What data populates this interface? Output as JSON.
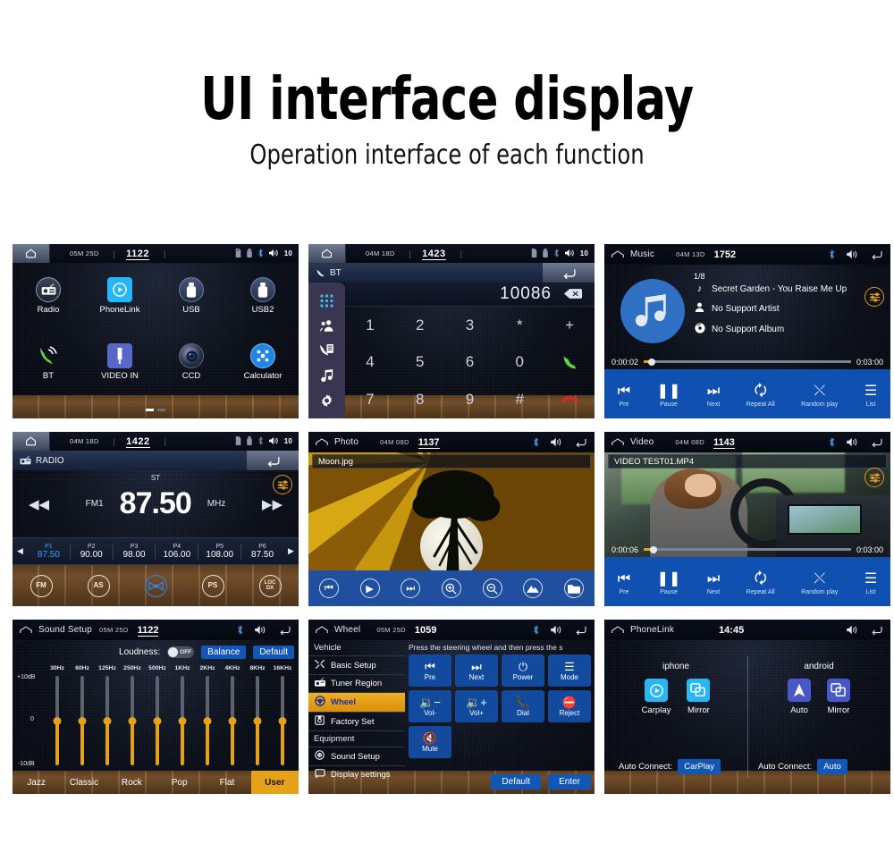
{
  "header": {
    "title": "UI interface display",
    "subtitle": "Operation interface of each function"
  },
  "colors": {
    "accent_blue": "#1050b0",
    "accent_orange": "#e3a21a",
    "panel_bg": "#05070f",
    "highlight_blue": "#3f9dfb"
  },
  "panels": {
    "home": {
      "name": "home-screen",
      "statusbar": {
        "home_icon": "home-icon",
        "date": "05M 25D",
        "clock": "11:22",
        "clock_display": "1122",
        "icons": [
          "sd-card-icon",
          "usb-icon",
          "bluetooth-icon",
          "volume-icon"
        ],
        "volume": "10"
      },
      "apps": [
        {
          "label": "Radio",
          "icon": "radio-icon"
        },
        {
          "label": "PhoneLink",
          "icon": "play-circle-icon"
        },
        {
          "label": "USB",
          "icon": "usb-icon"
        },
        {
          "label": "USB2",
          "icon": "usb-icon"
        },
        {
          "label": "BT",
          "icon": "phone-bluetooth-icon"
        },
        {
          "label": "VIDEO IN",
          "icon": "video-in-icon"
        },
        {
          "label": "CCD",
          "icon": "camera-icon"
        },
        {
          "label": "Calculator",
          "icon": "calculator-icon"
        }
      ],
      "page_dots": 2,
      "active_dot": 0
    },
    "bt": {
      "name": "bluetooth-dialer",
      "statusbar": {
        "date": "04M 18D",
        "clock_display": "1423",
        "volume": "10"
      },
      "subtitle": "BT",
      "back_icon": "back-arrow-icon",
      "sidebar": [
        "keypad-icon",
        "contacts-icon",
        "call-log-icon",
        "bt-music-icon",
        "bt-settings-icon"
      ],
      "dialed_number": "10086",
      "delete_icon": "backspace-icon",
      "keys": [
        "1",
        "2",
        "3",
        "*",
        "call-icon",
        "4",
        "5",
        "6",
        "0",
        "",
        "7",
        "8",
        "9",
        "#",
        "hangup-icon"
      ],
      "keys_flat": [
        {
          "k": "1"
        },
        {
          "k": "2"
        },
        {
          "k": "3"
        },
        {
          "k": "*"
        },
        {
          "k": "+"
        },
        {
          "k": "4"
        },
        {
          "k": "5"
        },
        {
          "k": "6"
        },
        {
          "k": "0"
        },
        {
          "k": "call-icon"
        },
        {
          "k": "7"
        },
        {
          "k": "8"
        },
        {
          "k": "9"
        },
        {
          "k": "#"
        },
        {
          "k": "hangup-icon"
        }
      ]
    },
    "music": {
      "name": "music-player",
      "statusbar": {
        "title": "Music",
        "date": "04M 13D",
        "clock_display": "1752"
      },
      "track_index": "1/8",
      "track_title": "Secret Garden - You Raise Me Up",
      "artist": "No Support Artist",
      "album": "No Support Album",
      "time_current": "0:00:02",
      "time_total": "0:03:00",
      "progress_pct": 2,
      "eq_badge": "equalizer-icon",
      "controls": [
        {
          "label": "Pre",
          "icon": "previous-icon"
        },
        {
          "label": "Pause",
          "icon": "pause-icon"
        },
        {
          "label": "Next",
          "icon": "next-icon"
        },
        {
          "label": "Repeat All",
          "icon": "repeat-icon"
        },
        {
          "label": "Random play",
          "icon": "shuffle-icon"
        },
        {
          "label": "List",
          "icon": "list-icon"
        }
      ]
    },
    "radio": {
      "name": "radio-tuner",
      "statusbar": {
        "date": "04M 18D",
        "clock_display": "1422",
        "volume": "10"
      },
      "subtitle": "RADIO",
      "stereo": "ST",
      "band": "FM1",
      "frequency": "87.50",
      "unit": "MHz",
      "presets": [
        {
          "name": "P1",
          "freq": "87.50",
          "active": true
        },
        {
          "name": "P2",
          "freq": "90.00",
          "active": false
        },
        {
          "name": "P3",
          "freq": "98.00",
          "active": false
        },
        {
          "name": "P4",
          "freq": "106.00",
          "active": false
        },
        {
          "name": "P5",
          "freq": "108.00",
          "active": false
        },
        {
          "name": "P6",
          "freq": "87.50",
          "active": false
        }
      ],
      "buttons": [
        {
          "label": "FM",
          "active": false
        },
        {
          "label": "AS",
          "active": false
        },
        {
          "label": "scan-icon",
          "active": true
        },
        {
          "label": "PS",
          "active": false
        },
        {
          "label": "LOC DX",
          "active": false
        }
      ]
    },
    "photo": {
      "name": "photo-viewer",
      "statusbar": {
        "title": "Photo",
        "date": "04M 08D",
        "clock_display": "1137"
      },
      "filename": "Moon.jpg",
      "controls": [
        {
          "icon": "previous-icon"
        },
        {
          "icon": "play-icon"
        },
        {
          "icon": "next-icon"
        },
        {
          "icon": "zoom-in-icon"
        },
        {
          "icon": "zoom-out-icon"
        },
        {
          "icon": "rotate-icon"
        },
        {
          "icon": "folder-icon"
        }
      ]
    },
    "video": {
      "name": "video-player",
      "statusbar": {
        "title": "Video",
        "date": "04M 08D",
        "clock_display": "1143"
      },
      "filename": "VIDEO TEST01.MP4",
      "time_current": "0:00:06",
      "time_total": "0:03:00",
      "progress_pct": 3,
      "eq_badge": "equalizer-icon",
      "controls": [
        {
          "label": "Pre",
          "icon": "previous-icon"
        },
        {
          "label": "Pause",
          "icon": "pause-icon"
        },
        {
          "label": "Next",
          "icon": "next-icon"
        },
        {
          "label": "Repeat All",
          "icon": "repeat-icon"
        },
        {
          "label": "Random play",
          "icon": "shuffle-icon"
        },
        {
          "label": "List",
          "icon": "list-icon"
        }
      ]
    },
    "sound": {
      "name": "sound-setup",
      "statusbar": {
        "title": "Sound Setup",
        "date": "05M 25D",
        "clock_display": "1122"
      },
      "loudness_label": "Loudness:",
      "loudness_state": "OFF",
      "balance_label": "Balance",
      "default_label": "Default",
      "bands": [
        "30Hz",
        "60Hz",
        "125Hz",
        "250Hz",
        "500Hz",
        "1KHz",
        "2KHz",
        "4KHz",
        "8KHz",
        "16KHz"
      ],
      "band_values": [
        0,
        0,
        0,
        0,
        0,
        0,
        0,
        0,
        0,
        0
      ],
      "scale_top": "+10dB",
      "scale_mid": "0",
      "scale_bottom": "-10dB",
      "eq_presets": [
        {
          "label": "Jazz",
          "active": false
        },
        {
          "label": "Classic",
          "active": false
        },
        {
          "label": "Rock",
          "active": false
        },
        {
          "label": "Pop",
          "active": false
        },
        {
          "label": "Flat",
          "active": false
        },
        {
          "label": "User",
          "active": true
        }
      ]
    },
    "wheel": {
      "name": "steering-wheel-setup",
      "statusbar": {
        "title": "Wheel",
        "date": "05M 25D",
        "clock_display": "1059"
      },
      "hint": "Press the steering wheel and then press the s",
      "menu": [
        {
          "label": "Vehicle",
          "type": "group"
        },
        {
          "label": "Basic Setup",
          "type": "item",
          "icon": "tools-icon",
          "active": false
        },
        {
          "label": "Tuner Region",
          "type": "item",
          "icon": "radio-icon",
          "active": false
        },
        {
          "label": "Wheel",
          "type": "item",
          "icon": "wheel-icon",
          "active": true
        },
        {
          "label": "Factory Set",
          "type": "item",
          "icon": "factory-icon",
          "active": false
        },
        {
          "label": "Equipment",
          "type": "group"
        },
        {
          "label": "Sound Setup",
          "type": "item",
          "icon": "speaker-icon",
          "active": false
        },
        {
          "label": "Display settings",
          "type": "item",
          "icon": "display-icon",
          "active": false
        }
      ],
      "keys": [
        {
          "label": "Pre",
          "icon": "previous-icon"
        },
        {
          "label": "Next",
          "icon": "next-icon"
        },
        {
          "label": "Power",
          "icon": "power-icon"
        },
        {
          "label": "Mode",
          "icon": "menu-icon"
        },
        {
          "label": "Vol-",
          "icon": "volume-down-icon"
        },
        {
          "label": "Vol+",
          "icon": "volume-up-icon"
        },
        {
          "label": "Dial",
          "icon": "dial-icon"
        },
        {
          "label": "Reject",
          "icon": "reject-call-icon"
        },
        {
          "label": "Mute",
          "icon": "mute-icon"
        }
      ],
      "footer": [
        {
          "label": "Default"
        },
        {
          "label": "Enter"
        }
      ]
    },
    "phonelink": {
      "name": "phonelink-screen",
      "statusbar": {
        "title": "PhoneLink",
        "clock_display": "14:45"
      },
      "iphone": {
        "title": "iphone",
        "items": [
          {
            "label": "Carplay",
            "icon": "carplay-icon"
          },
          {
            "label": "Mirror",
            "icon": "mirror-icon"
          }
        ],
        "autoconnect_label": "Auto Connect:",
        "autoconnect_value": "CarPlay"
      },
      "android": {
        "title": "android",
        "items": [
          {
            "label": "Auto",
            "icon": "android-auto-icon"
          },
          {
            "label": "Mirror",
            "icon": "mirror-icon"
          }
        ],
        "autoconnect_label": "Auto Connect:",
        "autoconnect_value": "Auto"
      }
    }
  }
}
